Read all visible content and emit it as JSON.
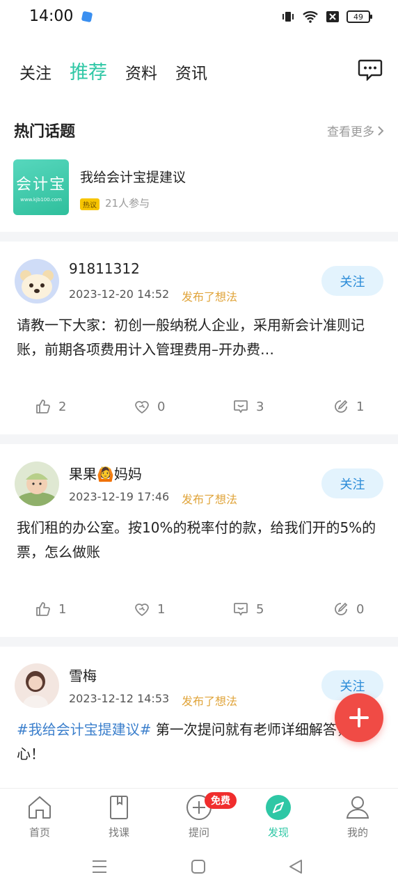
{
  "status_bar": {
    "time": "14:00",
    "battery": "49"
  },
  "top_tabs": [
    "关注",
    "推荐",
    "资料",
    "资讯"
  ],
  "hot_topics": {
    "title": "热门话题",
    "see_more": "查看更多",
    "topic": {
      "thumb_text": "会计宝",
      "thumb_url": "www.kjb100.com",
      "name": "我给会计宝提建议",
      "badge": "热议",
      "participants": "21人参与"
    }
  },
  "posts": [
    {
      "author": "91811312",
      "time": "2023-12-20 14:52",
      "action": "发布了想法",
      "follow": "关注",
      "text": "请教一下大家：初创一般纳税人企业，采用新会计准则记账，前期各项费用计入管理费用–开办费…",
      "likes": "2",
      "favorites": "0",
      "comments": "3",
      "shares": "1"
    },
    {
      "author": "果果🙆妈妈",
      "time": "2023-12-19 17:46",
      "action": "发布了想法",
      "follow": "关注",
      "text": "我们租的办公室。按10%的税率付的款，给我们开的5%的票，怎么做账",
      "likes": "1",
      "favorites": "1",
      "comments": "5",
      "shares": "0"
    },
    {
      "author": "雪梅",
      "time": "2023-12-12 14:53",
      "action": "发布了想法",
      "follow": "关注",
      "hashtag": "#我给会计宝提建议#",
      "text": " 第一次提问就有老师详细解答，好开心！"
    }
  ],
  "bottom_nav": [
    {
      "label": "首页",
      "icon": "home-icon"
    },
    {
      "label": "找课",
      "icon": "book-icon"
    },
    {
      "label": "提问",
      "icon": "plus-circle-icon"
    },
    {
      "label": "发现",
      "icon": "compass-icon"
    },
    {
      "label": "我的",
      "icon": "user-icon"
    }
  ],
  "free_badge": "免费",
  "accent_color": "#2ec7a5",
  "fab_color": "#f04b45"
}
